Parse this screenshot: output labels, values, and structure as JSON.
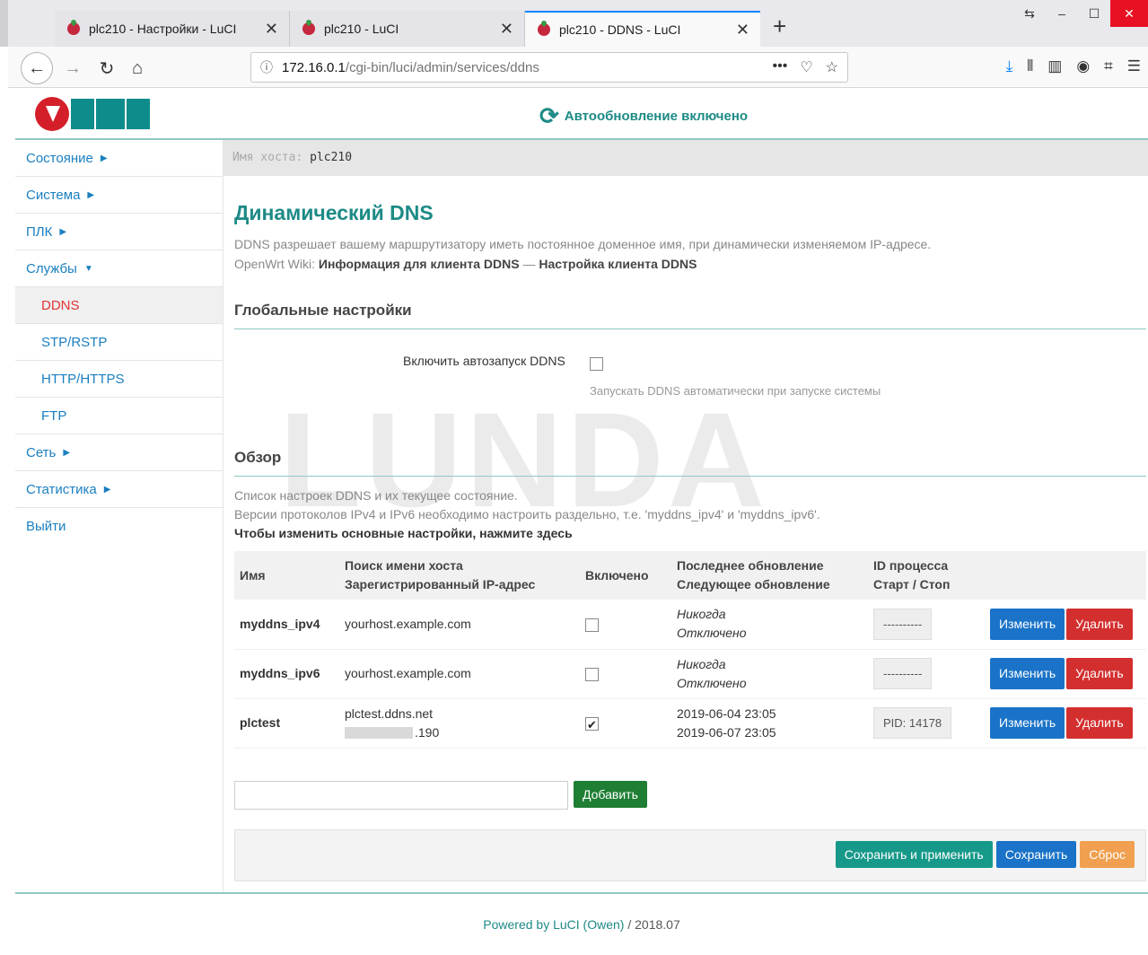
{
  "browser": {
    "tabs": [
      {
        "title": "plc210 - Настройки - LuCI",
        "active": false
      },
      {
        "title": "plc210 - LuCI",
        "active": false
      },
      {
        "title": "plc210 - DDNS - LuCI",
        "active": true
      }
    ],
    "url_host": "172.16.0.1",
    "url_path": "/cgi-bin/luci/admin/services/ddns"
  },
  "header": {
    "autorefresh": "Автообновление включено"
  },
  "sidebar": {
    "items": [
      {
        "label": "Состояние",
        "caret": "▶"
      },
      {
        "label": "Система",
        "caret": "▶"
      },
      {
        "label": "ПЛК",
        "caret": "▶"
      },
      {
        "label": "Службы",
        "caret": "▼"
      },
      {
        "label": "DDNS",
        "sub": true,
        "active": true
      },
      {
        "label": "STP/RSTP",
        "sub": true
      },
      {
        "label": "HTTP/HTTPS",
        "sub": true
      },
      {
        "label": "FTP",
        "sub": true
      },
      {
        "label": "Сеть",
        "caret": "▶"
      },
      {
        "label": "Статистика",
        "caret": "▶"
      },
      {
        "label": "Выйти"
      }
    ]
  },
  "hostbar": {
    "label": "Имя хоста:",
    "hostname": "plc210"
  },
  "main": {
    "title": "Динамический DNS",
    "description": "DDNS разрешает вашему маршрутизатору иметь постоянное доменное имя, при динамически изменяемом IP-адресе.",
    "wiki_prefix": "OpenWrt Wiki:",
    "wiki_link1": "Информация для клиента DDNS",
    "wiki_sep": " — ",
    "wiki_link2": "Настройка клиента DDNS",
    "global_title": "Глобальные настройки",
    "autostart_label": "Включить автозапуск DDNS",
    "autostart_help": "Запускать DDNS автоматически при запуске системы",
    "overview_title": "Обзор",
    "overview_note1": "Список настроек DDNS и их текущее состояние.",
    "overview_note2": "Версии протоколов IPv4 и IPv6 необходимо настроить раздельно, т.е. 'myddns_ipv4' и 'myddns_ipv6'.",
    "overview_note3": "Чтобы изменить основные настройки, нажмите здесь"
  },
  "table": {
    "headers": {
      "name": "Имя",
      "lookup1": "Поиск имени хоста",
      "lookup2": "Зарегистрированный IP-адрес",
      "enabled": "Включено",
      "update1": "Последнее обновление",
      "update2": "Следующее обновление",
      "pid1": "ID процесса",
      "pid2": "Старт / Стоп"
    },
    "rows": [
      {
        "name": "myddns_ipv4",
        "host": "yourhost.example.com",
        "ip": "",
        "enabled": false,
        "last": "Никогда",
        "next": "Отключено",
        "pid": "----------",
        "edit": "Изменить",
        "delete": "Удалить"
      },
      {
        "name": "myddns_ipv6",
        "host": "yourhost.example.com",
        "ip": "",
        "enabled": false,
        "last": "Никогда",
        "next": "Отключено",
        "pid": "----------",
        "edit": "Изменить",
        "delete": "Удалить"
      },
      {
        "name": "plctest",
        "host": "plctest.ddns.net",
        "ip": ".190",
        "enabled": true,
        "last": "2019-06-04 23:05",
        "next": "2019-06-07 23:05",
        "pid": "PID: 14178",
        "edit": "Изменить",
        "delete": "Удалить"
      }
    ]
  },
  "actions": {
    "add": "Добавить",
    "save_apply": "Сохранить и применить",
    "save": "Сохранить",
    "reset": "Сброс"
  },
  "footer": {
    "powered": "Powered by LuCI (Owen)",
    "version": " / 2018.07"
  },
  "watermark": "LUNDA"
}
